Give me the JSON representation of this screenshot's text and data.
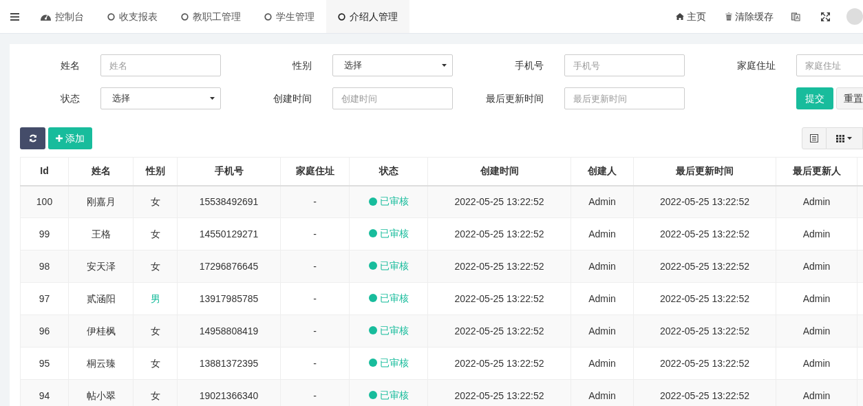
{
  "nav": {
    "tabs": [
      {
        "label": "控制台",
        "kind": "dashboard",
        "selected": false
      },
      {
        "label": "收支报表",
        "kind": "circle",
        "selected": false
      },
      {
        "label": "教职工管理",
        "kind": "circle",
        "selected": false
      },
      {
        "label": "学生管理",
        "kind": "circle",
        "selected": false
      },
      {
        "label": "介绍人管理",
        "kind": "circle",
        "selected": true
      }
    ],
    "links": [
      {
        "label": "主页",
        "kind": "home"
      },
      {
        "label": "清除缓存",
        "kind": "trash"
      }
    ]
  },
  "filters": [
    {
      "label": "姓名",
      "kind": "text",
      "placeholder": "姓名"
    },
    {
      "label": "性别",
      "kind": "select",
      "value": "选择"
    },
    {
      "label": "手机号",
      "kind": "text",
      "placeholder": "手机号"
    },
    {
      "label": "家庭住址",
      "kind": "text",
      "placeholder": "家庭住址"
    },
    {
      "label": "状态",
      "kind": "select",
      "value": "选择"
    },
    {
      "label": "创建时间",
      "kind": "text",
      "placeholder": "创建时间"
    },
    {
      "label": "最后更新时间",
      "kind": "text",
      "placeholder": "最后更新时间"
    }
  ],
  "form_buttons": [
    "提交",
    "重置"
  ],
  "toolbar": {
    "add": "添加"
  },
  "table": {
    "columns": [
      "Id",
      "姓名",
      "性别",
      "手机号",
      "家庭住址",
      "状态",
      "创建时间",
      "创建人",
      "最后更新时间",
      "最后更新人"
    ],
    "rows": [
      {
        "id": "100",
        "name": "刚嘉月",
        "gender": {
          "text": "女",
          "color": "#333333"
        },
        "phone": "15538492691",
        "address": "-",
        "status": {
          "text": "已审核",
          "color": "#18bc9c"
        },
        "created": "2022-05-25 13:22:52",
        "creator": "Admin",
        "updated": "2022-05-25 13:22:52",
        "updater": "Admin"
      },
      {
        "id": "99",
        "name": "王格",
        "gender": {
          "text": "女",
          "color": "#333333"
        },
        "phone": "14550129271",
        "address": "-",
        "status": {
          "text": "已审核",
          "color": "#18bc9c"
        },
        "created": "2022-05-25 13:22:52",
        "creator": "Admin",
        "updated": "2022-05-25 13:22:52",
        "updater": "Admin"
      },
      {
        "id": "98",
        "name": "安天泽",
        "gender": {
          "text": "女",
          "color": "#333333"
        },
        "phone": "17296876645",
        "address": "-",
        "status": {
          "text": "已审核",
          "color": "#18bc9c"
        },
        "created": "2022-05-25 13:22:52",
        "creator": "Admin",
        "updated": "2022-05-25 13:22:52",
        "updater": "Admin"
      },
      {
        "id": "97",
        "name": "贰涵阳",
        "gender": {
          "text": "男",
          "color": "#18bc9c"
        },
        "phone": "13917985785",
        "address": "-",
        "status": {
          "text": "已审核",
          "color": "#18bc9c"
        },
        "created": "2022-05-25 13:22:52",
        "creator": "Admin",
        "updated": "2022-05-25 13:22:52",
        "updater": "Admin"
      },
      {
        "id": "96",
        "name": "伊桂枫",
        "gender": {
          "text": "女",
          "color": "#333333"
        },
        "phone": "14958808419",
        "address": "-",
        "status": {
          "text": "已审核",
          "color": "#18bc9c"
        },
        "created": "2022-05-25 13:22:52",
        "creator": "Admin",
        "updated": "2022-05-25 13:22:52",
        "updater": "Admin"
      },
      {
        "id": "95",
        "name": "桐云臻",
        "gender": {
          "text": "女",
          "color": "#333333"
        },
        "phone": "13881372395",
        "address": "-",
        "status": {
          "text": "已审核",
          "color": "#18bc9c"
        },
        "created": "2022-05-25 13:22:52",
        "creator": "Admin",
        "updated": "2022-05-25 13:22:52",
        "updater": "Admin"
      },
      {
        "id": "94",
        "name": "帖小翠",
        "gender": {
          "text": "女",
          "color": "#333333"
        },
        "phone": "19021366340",
        "address": "-",
        "status": {
          "text": "已审核",
          "color": "#18bc9c"
        },
        "created": "2022-05-25 13:22:52",
        "creator": "Admin",
        "updated": "2022-05-25 13:22:52",
        "updater": "Admin"
      }
    ]
  }
}
